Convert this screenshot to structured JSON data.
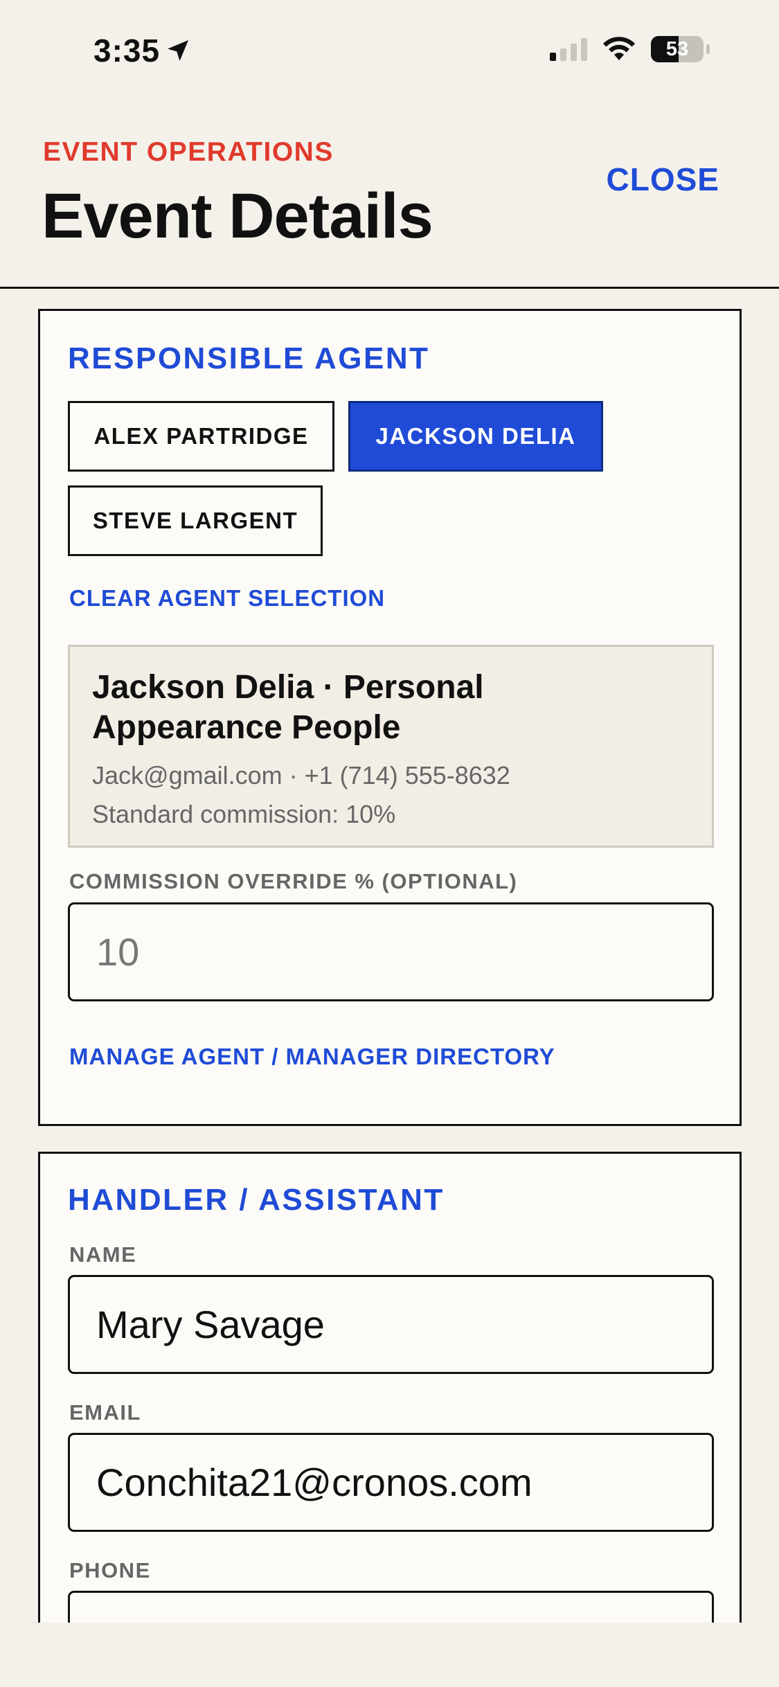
{
  "status_bar": {
    "time": "3:35",
    "battery": "53",
    "battery_level": 0.53
  },
  "header": {
    "eyebrow": "EVENT OPERATIONS",
    "title": "Event Details",
    "close_label": "CLOSE"
  },
  "agent_section": {
    "title": "RESPONSIBLE AGENT",
    "agents": [
      {
        "label": "ALEX PARTRIDGE",
        "selected": false
      },
      {
        "label": "JACKSON DELIA",
        "selected": true
      },
      {
        "label": "STEVE LARGENT",
        "selected": false
      }
    ],
    "clear_label": "CLEAR AGENT SELECTION",
    "selected_agent": {
      "heading": "Jackson Delia · Personal Appearance People",
      "contact": "Jack@gmail.com · +1 (714) 555-8632",
      "commission": "Standard commission: 10%"
    },
    "commission_override_label": "COMMISSION OVERRIDE % (OPTIONAL)",
    "commission_override_placeholder": "10",
    "commission_override_value": "",
    "manage_directory_label": "MANAGE AGENT / MANAGER DIRECTORY"
  },
  "handler_section": {
    "title": "HANDLER / ASSISTANT",
    "name_label": "NAME",
    "name_value": "Mary Savage",
    "email_label": "EMAIL",
    "email_value": "Conchita21@cronos.com",
    "phone_label": "PHONE",
    "phone_value": ""
  },
  "colors": {
    "accent_blue": "#1f4bd6",
    "eyebrow_red": "#e03a2c",
    "background": "#f4f1ea"
  }
}
